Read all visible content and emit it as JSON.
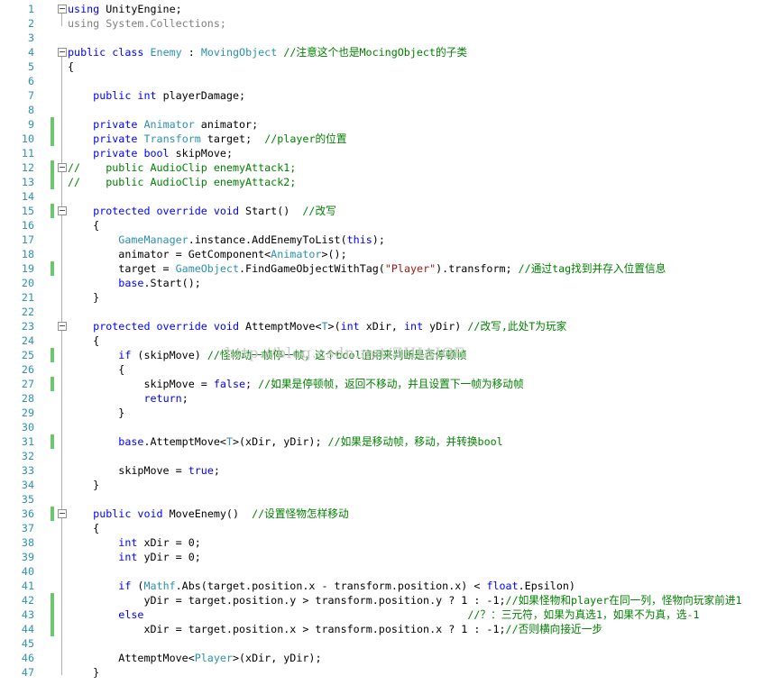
{
  "editor": {
    "watermark": "http://blog.csdn.net/ZHIAIGE",
    "colors": {
      "keyword": "#0000ff",
      "type": "#2b91af",
      "comment": "#008000",
      "string": "#a31515",
      "line_number": "#2b91af",
      "change_marker": "#6ac76a"
    },
    "lines": [
      {
        "n": "1",
        "fold": true,
        "changed": false,
        "tokens": [
          {
            "t": "kw",
            "v": "using"
          },
          {
            "t": "pl",
            "v": " UnityEngine;"
          }
        ]
      },
      {
        "n": "2",
        "fold": false,
        "changed": false,
        "tokens": [
          {
            "t": "gr",
            "v": "using System.Collections;"
          }
        ]
      },
      {
        "n": "3",
        "fold": false,
        "changed": false,
        "tokens": []
      },
      {
        "n": "4",
        "fold": true,
        "changed": false,
        "tokens": [
          {
            "t": "kw",
            "v": "public class"
          },
          {
            "t": "pl",
            "v": " "
          },
          {
            "t": "ty",
            "v": "Enemy"
          },
          {
            "t": "pl",
            "v": " : "
          },
          {
            "t": "ty",
            "v": "MovingObject"
          },
          {
            "t": "pl",
            "v": " "
          },
          {
            "t": "cm",
            "v": "//注意这个也是MocingObject的子类"
          }
        ]
      },
      {
        "n": "5",
        "fold": false,
        "changed": false,
        "tokens": [
          {
            "t": "pl",
            "v": "{"
          }
        ]
      },
      {
        "n": "6",
        "fold": false,
        "changed": false,
        "tokens": []
      },
      {
        "n": "7",
        "fold": false,
        "changed": false,
        "tokens": [
          {
            "t": "pl",
            "v": "    "
          },
          {
            "t": "kw",
            "v": "public int"
          },
          {
            "t": "pl",
            "v": " playerDamage;"
          }
        ]
      },
      {
        "n": "8",
        "fold": false,
        "changed": false,
        "tokens": []
      },
      {
        "n": "9",
        "fold": false,
        "changed": true,
        "tokens": [
          {
            "t": "pl",
            "v": "    "
          },
          {
            "t": "kw",
            "v": "private"
          },
          {
            "t": "pl",
            "v": " "
          },
          {
            "t": "ty",
            "v": "Animator"
          },
          {
            "t": "pl",
            "v": " animator;"
          }
        ]
      },
      {
        "n": "10",
        "fold": false,
        "changed": true,
        "tokens": [
          {
            "t": "pl",
            "v": "    "
          },
          {
            "t": "kw",
            "v": "private"
          },
          {
            "t": "pl",
            "v": " "
          },
          {
            "t": "ty",
            "v": "Transform"
          },
          {
            "t": "pl",
            "v": " target;  "
          },
          {
            "t": "cm",
            "v": "//player的位置"
          }
        ]
      },
      {
        "n": "11",
        "fold": false,
        "changed": false,
        "tokens": [
          {
            "t": "pl",
            "v": "    "
          },
          {
            "t": "kw",
            "v": "private bool"
          },
          {
            "t": "pl",
            "v": " skipMove;"
          }
        ]
      },
      {
        "n": "12",
        "fold": true,
        "changed": true,
        "tokens": [
          {
            "t": "cm",
            "v": "//    public AudioClip enemyAttack1;"
          }
        ]
      },
      {
        "n": "13",
        "fold": false,
        "changed": true,
        "tokens": [
          {
            "t": "cm",
            "v": "//    public AudioClip enemyAttack2;"
          }
        ]
      },
      {
        "n": "14",
        "fold": false,
        "changed": false,
        "tokens": []
      },
      {
        "n": "15",
        "fold": true,
        "changed": true,
        "tokens": [
          {
            "t": "pl",
            "v": "    "
          },
          {
            "t": "kw",
            "v": "protected override void"
          },
          {
            "t": "pl",
            "v": " Start()  "
          },
          {
            "t": "cm",
            "v": "//改写"
          }
        ]
      },
      {
        "n": "16",
        "fold": false,
        "changed": false,
        "tokens": [
          {
            "t": "pl",
            "v": "    {"
          }
        ]
      },
      {
        "n": "17",
        "fold": false,
        "changed": false,
        "tokens": [
          {
            "t": "pl",
            "v": "        "
          },
          {
            "t": "ty",
            "v": "GameManager"
          },
          {
            "t": "pl",
            "v": ".instance.AddEnemyToList("
          },
          {
            "t": "kw",
            "v": "this"
          },
          {
            "t": "pl",
            "v": ");"
          }
        ]
      },
      {
        "n": "18",
        "fold": false,
        "changed": false,
        "tokens": [
          {
            "t": "pl",
            "v": "        animator = GetComponent<"
          },
          {
            "t": "ty",
            "v": "Animator"
          },
          {
            "t": "pl",
            "v": ">();"
          }
        ]
      },
      {
        "n": "19",
        "fold": false,
        "changed": true,
        "tokens": [
          {
            "t": "pl",
            "v": "        target = "
          },
          {
            "t": "ty",
            "v": "GameObject"
          },
          {
            "t": "pl",
            "v": ".FindGameObjectWithTag("
          },
          {
            "t": "st",
            "v": "\"Player\""
          },
          {
            "t": "pl",
            "v": ").transform; "
          },
          {
            "t": "cm",
            "v": "//通过tag找到并存入位置信息"
          }
        ]
      },
      {
        "n": "20",
        "fold": false,
        "changed": false,
        "tokens": [
          {
            "t": "pl",
            "v": "        "
          },
          {
            "t": "kw",
            "v": "base"
          },
          {
            "t": "pl",
            "v": ".Start();"
          }
        ]
      },
      {
        "n": "21",
        "fold": false,
        "changed": false,
        "tokens": [
          {
            "t": "pl",
            "v": "    }"
          }
        ]
      },
      {
        "n": "22",
        "fold": false,
        "changed": false,
        "tokens": []
      },
      {
        "n": "23",
        "fold": true,
        "changed": false,
        "tokens": [
          {
            "t": "pl",
            "v": "    "
          },
          {
            "t": "kw",
            "v": "protected override void"
          },
          {
            "t": "pl",
            "v": " AttemptMove<"
          },
          {
            "t": "ty",
            "v": "T"
          },
          {
            "t": "pl",
            "v": ">("
          },
          {
            "t": "kw",
            "v": "int"
          },
          {
            "t": "pl",
            "v": " xDir, "
          },
          {
            "t": "kw",
            "v": "int"
          },
          {
            "t": "pl",
            "v": " yDir) "
          },
          {
            "t": "cm",
            "v": "//改写,此处T为玩家"
          }
        ]
      },
      {
        "n": "24",
        "fold": false,
        "changed": false,
        "tokens": [
          {
            "t": "pl",
            "v": "    {"
          }
        ]
      },
      {
        "n": "25",
        "fold": false,
        "changed": true,
        "tokens": [
          {
            "t": "pl",
            "v": "        "
          },
          {
            "t": "kw",
            "v": "if"
          },
          {
            "t": "pl",
            "v": " (skipMove) "
          },
          {
            "t": "cm",
            "v": "//怪物动一帧停一帧，这个bool值用来判断是否停顿帧"
          }
        ]
      },
      {
        "n": "26",
        "fold": false,
        "changed": false,
        "tokens": [
          {
            "t": "pl",
            "v": "        {"
          }
        ]
      },
      {
        "n": "27",
        "fold": false,
        "changed": true,
        "tokens": [
          {
            "t": "pl",
            "v": "            skipMove = "
          },
          {
            "t": "kw",
            "v": "false"
          },
          {
            "t": "pl",
            "v": "; "
          },
          {
            "t": "cm",
            "v": "//如果是停顿帧，返回不移动，并且设置下一帧为移动帧"
          }
        ]
      },
      {
        "n": "28",
        "fold": false,
        "changed": false,
        "tokens": [
          {
            "t": "pl",
            "v": "            "
          },
          {
            "t": "kw",
            "v": "return"
          },
          {
            "t": "pl",
            "v": ";"
          }
        ]
      },
      {
        "n": "29",
        "fold": false,
        "changed": false,
        "tokens": [
          {
            "t": "pl",
            "v": "        }"
          }
        ]
      },
      {
        "n": "30",
        "fold": false,
        "changed": false,
        "tokens": []
      },
      {
        "n": "31",
        "fold": false,
        "changed": true,
        "tokens": [
          {
            "t": "pl",
            "v": "        "
          },
          {
            "t": "kw",
            "v": "base"
          },
          {
            "t": "pl",
            "v": ".AttemptMove<"
          },
          {
            "t": "ty",
            "v": "T"
          },
          {
            "t": "pl",
            "v": ">(xDir, yDir); "
          },
          {
            "t": "cm",
            "v": "//如果是移动帧，移动，并转换bool"
          }
        ]
      },
      {
        "n": "32",
        "fold": false,
        "changed": false,
        "tokens": []
      },
      {
        "n": "33",
        "fold": false,
        "changed": false,
        "tokens": [
          {
            "t": "pl",
            "v": "        skipMove = "
          },
          {
            "t": "kw",
            "v": "true"
          },
          {
            "t": "pl",
            "v": ";"
          }
        ]
      },
      {
        "n": "34",
        "fold": false,
        "changed": false,
        "tokens": [
          {
            "t": "pl",
            "v": "    }"
          }
        ]
      },
      {
        "n": "35",
        "fold": false,
        "changed": false,
        "tokens": []
      },
      {
        "n": "36",
        "fold": true,
        "changed": true,
        "tokens": [
          {
            "t": "pl",
            "v": "    "
          },
          {
            "t": "kw",
            "v": "public void"
          },
          {
            "t": "pl",
            "v": " MoveEnemy()  "
          },
          {
            "t": "cm",
            "v": "//设置怪物怎样移动"
          }
        ]
      },
      {
        "n": "37",
        "fold": false,
        "changed": false,
        "tokens": [
          {
            "t": "pl",
            "v": "    {"
          }
        ]
      },
      {
        "n": "38",
        "fold": false,
        "changed": false,
        "tokens": [
          {
            "t": "pl",
            "v": "        "
          },
          {
            "t": "kw",
            "v": "int"
          },
          {
            "t": "pl",
            "v": " xDir = 0;"
          }
        ]
      },
      {
        "n": "39",
        "fold": false,
        "changed": false,
        "tokens": [
          {
            "t": "pl",
            "v": "        "
          },
          {
            "t": "kw",
            "v": "int"
          },
          {
            "t": "pl",
            "v": " yDir = 0;"
          }
        ]
      },
      {
        "n": "40",
        "fold": false,
        "changed": false,
        "tokens": []
      },
      {
        "n": "41",
        "fold": false,
        "changed": false,
        "tokens": [
          {
            "t": "pl",
            "v": "        "
          },
          {
            "t": "kw",
            "v": "if"
          },
          {
            "t": "pl",
            "v": " ("
          },
          {
            "t": "ty",
            "v": "Mathf"
          },
          {
            "t": "pl",
            "v": ".Abs(target.position.x - transform.position.x) < "
          },
          {
            "t": "kw",
            "v": "float"
          },
          {
            "t": "pl",
            "v": ".Epsilon)"
          }
        ]
      },
      {
        "n": "42",
        "fold": false,
        "changed": true,
        "tokens": [
          {
            "t": "pl",
            "v": "            yDir = target.position.y > transform.position.y ? 1 : -1;"
          },
          {
            "t": "cm",
            "v": "//如果怪物和player在同一列，怪物向玩家前进1"
          }
        ]
      },
      {
        "n": "43",
        "fold": false,
        "changed": true,
        "tokens": [
          {
            "t": "pl",
            "v": "        "
          },
          {
            "t": "kw",
            "v": "else"
          },
          {
            "t": "pl",
            "v": "                                                   "
          },
          {
            "t": "cm",
            "v": "//？：三元符，如果为真选1，如果不为真，选-1"
          }
        ]
      },
      {
        "n": "44",
        "fold": false,
        "changed": true,
        "tokens": [
          {
            "t": "pl",
            "v": "            xDir = target.position.x > transform.position.x ? 1 : -1;"
          },
          {
            "t": "cm",
            "v": "//否则横向接近一步"
          }
        ]
      },
      {
        "n": "45",
        "fold": false,
        "changed": false,
        "tokens": []
      },
      {
        "n": "46",
        "fold": false,
        "changed": false,
        "tokens": [
          {
            "t": "pl",
            "v": "        AttemptMove<"
          },
          {
            "t": "ty",
            "v": "Player"
          },
          {
            "t": "pl",
            "v": ">(xDir, yDir);"
          }
        ]
      },
      {
        "n": "47",
        "fold": false,
        "changed": false,
        "tokens": [
          {
            "t": "pl",
            "v": "    }"
          }
        ]
      }
    ]
  }
}
